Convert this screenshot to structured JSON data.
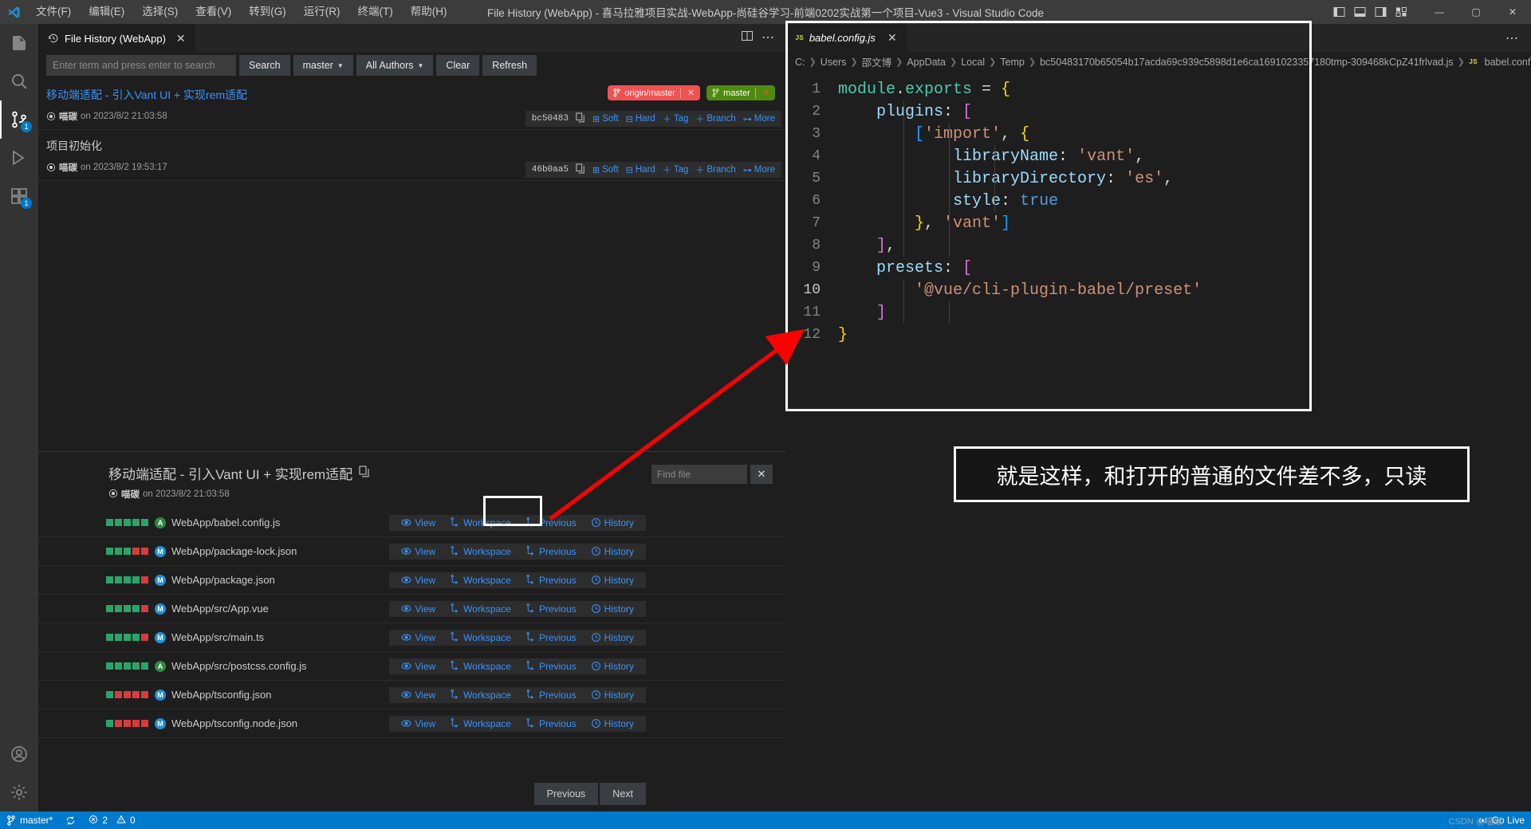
{
  "window": {
    "title": "File History (WebApp) - 喜马拉雅项目实战-WebApp-尚硅谷学习-前端0202实战第一个项目-Vue3 - Visual Studio Code",
    "menu": [
      "文件(F)",
      "编辑(E)",
      "选择(S)",
      "查看(V)",
      "转到(G)",
      "运行(R)",
      "终端(T)",
      "帮助(H)"
    ],
    "controls": {
      "minimize": "—",
      "maximize": "▢",
      "close": "✕"
    }
  },
  "activitybar": {
    "items": [
      {
        "name": "explorer",
        "badge": ""
      },
      {
        "name": "search",
        "badge": ""
      },
      {
        "name": "source-control",
        "badge": "1"
      },
      {
        "name": "run-debug",
        "badge": ""
      },
      {
        "name": "extensions",
        "badge": "1"
      }
    ],
    "bottom": [
      {
        "name": "accounts"
      },
      {
        "name": "settings"
      }
    ]
  },
  "left_panel": {
    "tab": {
      "label": "File History (WebApp)",
      "close": "✕"
    },
    "search": {
      "placeholder": "Enter term and press enter to search",
      "value": "",
      "buttons": [
        "Search",
        "Clear",
        "Refresh"
      ],
      "branch_filter": "master",
      "author_filter": "All Authors"
    },
    "commits": [
      {
        "title": "移动端适配 - 引入Vant UI + 实现rem适配",
        "author": "喵碳",
        "date": "on 2023/8/2 21:03:58",
        "hash": "bc50483",
        "refs": [
          {
            "label": "origin/master",
            "color": "#f05252",
            "type": "remote"
          },
          {
            "label": "master",
            "color": "#4f8a10",
            "type": "local"
          }
        ],
        "actions": [
          "Soft",
          "Hard",
          "Tag",
          "Branch",
          "More"
        ]
      },
      {
        "title": "项目初始化",
        "author": "喵碳",
        "date": "on 2023/8/2 19:53:17",
        "hash": "46b0aa5",
        "refs": [],
        "actions": [
          "Soft",
          "Hard",
          "Tag",
          "Branch",
          "More"
        ]
      }
    ]
  },
  "file_section": {
    "title": "移动端适配 - 引入Vant UI + 实现rem适配",
    "author": "喵碳",
    "date": "on 2023/8/2 21:03:58",
    "find": {
      "placeholder": "Find file",
      "value": "",
      "clear": "✕"
    },
    "row_actions": [
      "View",
      "Workspace",
      "Previous",
      "History"
    ],
    "files": [
      {
        "path": "WebApp/babel.config.js",
        "status": "A",
        "diff": [
          "g",
          "g",
          "g",
          "g",
          "g"
        ]
      },
      {
        "path": "WebApp/package-lock.json",
        "status": "M",
        "diff": [
          "g",
          "g",
          "g",
          "r",
          "r"
        ]
      },
      {
        "path": "WebApp/package.json",
        "status": "M",
        "diff": [
          "g",
          "g",
          "g",
          "g",
          "r"
        ]
      },
      {
        "path": "WebApp/src/App.vue",
        "status": "M",
        "diff": [
          "g",
          "g",
          "g",
          "g",
          "r"
        ]
      },
      {
        "path": "WebApp/src/main.ts",
        "status": "M",
        "diff": [
          "g",
          "g",
          "g",
          "g",
          "r"
        ]
      },
      {
        "path": "WebApp/src/postcss.config.js",
        "status": "A",
        "diff": [
          "g",
          "g",
          "g",
          "g",
          "g"
        ]
      },
      {
        "path": "WebApp/tsconfig.json",
        "status": "M",
        "diff": [
          "g",
          "r",
          "r",
          "r",
          "r"
        ]
      },
      {
        "path": "WebApp/tsconfig.node.json",
        "status": "M",
        "diff": [
          "g",
          "r",
          "r",
          "r",
          "r"
        ]
      }
    ],
    "pager": {
      "previous": "Previous",
      "next": "Next"
    }
  },
  "editor": {
    "tab": {
      "label": "babel.config.js",
      "close": "✕",
      "icon": "js-icon"
    },
    "breadcrumb": [
      "C:",
      "Users",
      "邵文博",
      "AppData",
      "Local",
      "Temp",
      "bc50483170b65054b17acda69c939c5898d1e6ca169102335718​0tmp-309468kCpZ41frlvad.js",
      "babel.config"
    ],
    "lines": [
      {
        "n": "1",
        "text": "module.exports = {"
      },
      {
        "n": "2",
        "text": "    plugins: ["
      },
      {
        "n": "3",
        "text": "        ['import', {"
      },
      {
        "n": "4",
        "text": "            libraryName: 'vant',"
      },
      {
        "n": "5",
        "text": "            libraryDirectory: 'es',"
      },
      {
        "n": "6",
        "text": "            style: true"
      },
      {
        "n": "7",
        "text": "        }, 'vant']"
      },
      {
        "n": "8",
        "text": "    ],"
      },
      {
        "n": "9",
        "text": "    presets: ["
      },
      {
        "n": "10",
        "text": "        '@vue/cli-plugin-babel/preset'"
      },
      {
        "n": "11",
        "text": "    ]"
      },
      {
        "n": "12",
        "text": "}"
      }
    ]
  },
  "annotation": {
    "text": "就是这样，和打开的普通的文件差不多，只读",
    "arrow_color": "#ff0000",
    "box_color": "#ffffff"
  },
  "statusbar": {
    "branch": "master*",
    "sync": "↻",
    "errors": "0",
    "warnings": "2",
    "errors_label": "2",
    "warnings_label": "0",
    "golive": "Go Live",
    "watermark": "CSDN @喵碳"
  }
}
